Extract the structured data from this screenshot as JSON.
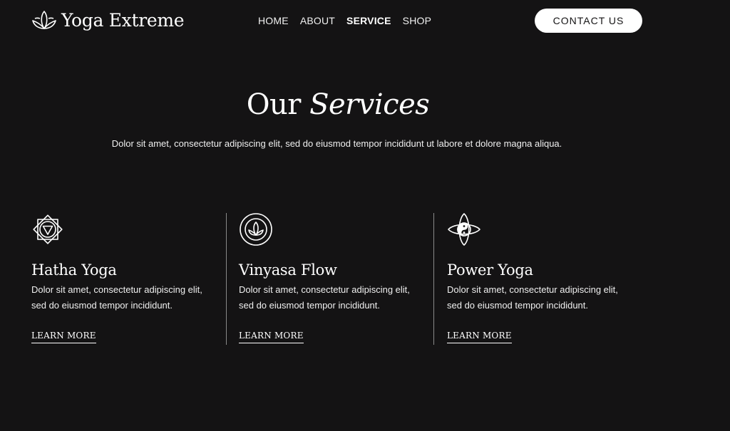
{
  "header": {
    "logo_text": "Yoga Extreme",
    "logo_icon": "lotus-icon",
    "nav": [
      {
        "label": "HOME",
        "active": false
      },
      {
        "label": "ABOUT",
        "active": false
      },
      {
        "label": "SERVICE",
        "active": true
      },
      {
        "label": "SHOP",
        "active": false
      }
    ],
    "contact_label": "CONTACT US"
  },
  "section": {
    "title_plain": "Our",
    "title_italic": "Services",
    "description": "Dolor sit amet, consectetur adipiscing elit, sed do eiusmod tempor incididunt ut labore et dolore magna aliqua."
  },
  "services": [
    {
      "icon": "chakra-triangle-icon",
      "title": "Hatha Yoga",
      "text": "Dolor sit amet, consectetur adipiscing elit, sed do eiusmod tempor incididunt.",
      "link": "LEARN MORE"
    },
    {
      "icon": "lotus-circle-icon",
      "title": "Vinyasa Flow",
      "text": "Dolor sit amet, consectetur adipiscing elit, sed do eiusmod tempor incididunt.",
      "link": "LEARN MORE"
    },
    {
      "icon": "yin-yang-lotus-icon",
      "title": "Power Yoga",
      "text": "Dolor sit amet, consectetur adipiscing elit, sed do eiusmod tempor incididunt.",
      "link": "LEARN MORE"
    }
  ],
  "colors": {
    "background": "#141314",
    "text": "#ffffff",
    "button_bg": "#ffffff",
    "button_text": "#141314",
    "divider": "#8a8a8a"
  }
}
